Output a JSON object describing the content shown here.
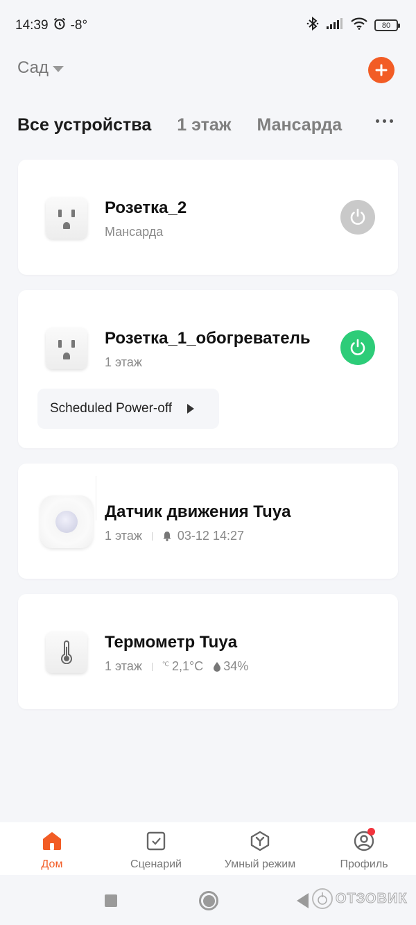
{
  "status_bar": {
    "time": "14:39",
    "temperature": "-8°",
    "battery": "80",
    "icons": [
      "alarm-icon",
      "bluetooth-icon",
      "signal-icon",
      "wifi-icon",
      "battery-icon"
    ]
  },
  "header": {
    "home_name": "Сад",
    "add_button_icon": "plus-icon"
  },
  "tabs": [
    {
      "label": "Все устройства",
      "active": true
    },
    {
      "label": "1 этаж",
      "active": false
    },
    {
      "label": "Мансарда",
      "active": false
    }
  ],
  "devices": [
    {
      "name": "Розетка_2",
      "room": "Мансарда",
      "icon": "socket-icon",
      "power": "off"
    },
    {
      "name": "Розетка_1_обогреватель",
      "room": "1 этаж",
      "icon": "socket-icon",
      "power": "on",
      "action_label": "Scheduled Power-off"
    },
    {
      "name": "Датчик движения Tuya",
      "room": "1 этаж",
      "icon": "motion-sensor-icon",
      "last_event": "03-12 14:27"
    },
    {
      "name": "Термометр Tuya",
      "room": "1 этаж",
      "icon": "thermometer-icon",
      "temperature": "2,1°C",
      "humidity": "34%"
    }
  ],
  "bottom_nav": [
    {
      "label": "Дом",
      "icon": "home-icon",
      "active": true
    },
    {
      "label": "Сценарий",
      "icon": "scene-checkbox-icon",
      "active": false
    },
    {
      "label": "Умный режим",
      "icon": "smart-mode-icon",
      "active": false
    },
    {
      "label": "Профиль",
      "icon": "profile-icon",
      "active": false,
      "badge": true
    }
  ],
  "watermark": "ОТЗОВИК",
  "colors": {
    "accent": "#f25c25",
    "power_on": "#2dcc78",
    "power_off": "#c9c9c9",
    "badge": "#f2333c",
    "background": "#f5f6f9"
  }
}
